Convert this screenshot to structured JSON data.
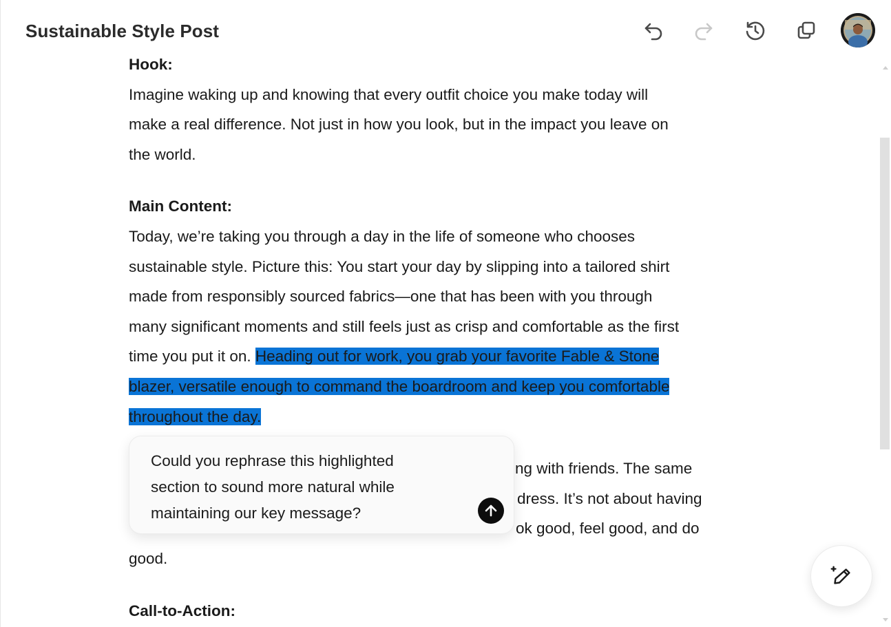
{
  "header": {
    "title": "Sustainable Style Post",
    "icons": {
      "undo": "undo-icon",
      "redo": "redo-icon",
      "history": "history-icon",
      "copy": "copy-icon",
      "avatar": "user-avatar"
    }
  },
  "document": {
    "hook_heading": "Hook:",
    "hook_lines": [
      "Imagine waking up and knowing that every outfit choice you make today will",
      "make a real difference. Not just in how you look, but in the impact you leave on",
      "the world."
    ],
    "main_heading": "Main Content:",
    "main_lines": [
      "Today, we’re taking you through a day in the life of someone who chooses",
      "sustainable style. Picture this: You start your day by slipping into a tailored shirt",
      "made from responsibly sourced fabrics—one that has been with you through",
      "many significant moments and still feels just as crisp and comfortable as the first"
    ],
    "main_line5_plain": "time you put it on. ",
    "main_line5_highlight": "Heading out for work, you grab your favorite Fable & Stone",
    "main_line6_highlight": "blazer, versatile enough to command the boardroom and keep you comfortable",
    "main_line7_highlight": "throughout the day.",
    "partial_line1_visible": "ering with friends. The same",
    "partial_line2_visible": "dress. It’s not about having",
    "partial_line3_visible": "ok good, feel good, and do",
    "last_line": "good.",
    "cta_heading": "Call-to-Action:"
  },
  "popover": {
    "text": "Could you rephrase this highlighted section to sound more natural while maintaining our key message?",
    "lines": [
      "Could you rephrase this highlighted",
      "section to sound more natural while",
      "maintaining our key message?"
    ],
    "send_icon": "arrow-up-icon"
  },
  "fab": {
    "icon": "edit-sparkle-icon"
  },
  "colors": {
    "highlight": "#0a74d6",
    "send_button": "#0d0d0d",
    "disabled_icon": "#c8c8c8",
    "icon": "#4a4a4a"
  }
}
